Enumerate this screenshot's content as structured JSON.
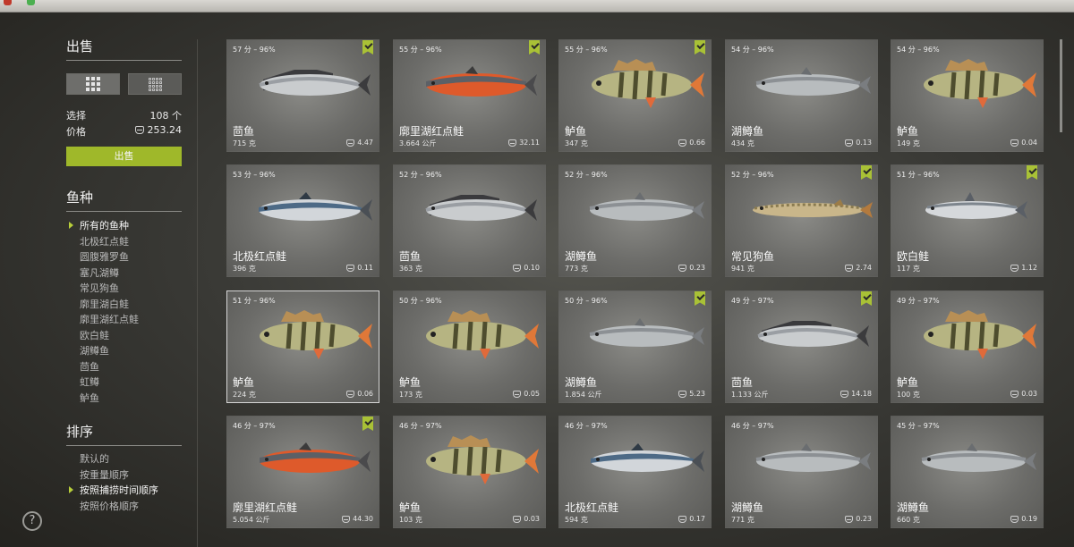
{
  "sidebar": {
    "sell_title": "出售",
    "select_label": "选择",
    "select_value": "108 个",
    "price_label": "价格",
    "price_value": "253.24",
    "sell_button": "出售",
    "species_title": "鱼种",
    "species": [
      {
        "label": "所有的鱼种",
        "selected": true
      },
      {
        "label": "北极红点鲑",
        "selected": false
      },
      {
        "label": "圆腹雅罗鱼",
        "selected": false
      },
      {
        "label": "塞凡湖鳟",
        "selected": false
      },
      {
        "label": "常见狗鱼",
        "selected": false
      },
      {
        "label": "廓里湖白鲑",
        "selected": false
      },
      {
        "label": "廓里湖红点鲑",
        "selected": false
      },
      {
        "label": "欧白鲑",
        "selected": false
      },
      {
        "label": "湖鳟鱼",
        "selected": false
      },
      {
        "label": "茴鱼",
        "selected": false
      },
      {
        "label": "虹鳟",
        "selected": false
      },
      {
        "label": "鲈鱼",
        "selected": false
      }
    ],
    "sort_title": "排序",
    "sort": [
      {
        "label": "默认的",
        "selected": false
      },
      {
        "label": "按重量顺序",
        "selected": false
      },
      {
        "label": "按照捕捞时间顺序",
        "selected": true
      },
      {
        "label": "按照价格顺序",
        "selected": false
      }
    ],
    "help_label": "?"
  },
  "fish": [
    {
      "score": "57 分 – 96%",
      "name": "茴鱼",
      "weight": "715 克",
      "price": "4.47",
      "checked": true,
      "kind": "grayling",
      "selected": false
    },
    {
      "score": "55 分 – 96%",
      "name": "廓里湖红点鲑",
      "weight": "3.664 公斤",
      "price": "32.11",
      "checked": true,
      "kind": "char_red",
      "selected": false
    },
    {
      "score": "55 分 – 96%",
      "name": "鲈鱼",
      "weight": "347 克",
      "price": "0.66",
      "checked": true,
      "kind": "perch",
      "selected": false
    },
    {
      "score": "54 分 – 96%",
      "name": "湖鳟鱼",
      "weight": "434 克",
      "price": "0.13",
      "checked": false,
      "kind": "trout",
      "selected": false
    },
    {
      "score": "54 分 – 96%",
      "name": "鲈鱼",
      "weight": "149 克",
      "price": "0.04",
      "checked": false,
      "kind": "perch",
      "selected": false
    },
    {
      "score": "53 分 – 96%",
      "name": "北极红点鲑",
      "weight": "396 克",
      "price": "0.11",
      "checked": false,
      "kind": "char_blue",
      "selected": false
    },
    {
      "score": "52 分 – 96%",
      "name": "茴鱼",
      "weight": "363 克",
      "price": "0.10",
      "checked": false,
      "kind": "grayling",
      "selected": false
    },
    {
      "score": "52 分 – 96%",
      "name": "湖鳟鱼",
      "weight": "773 克",
      "price": "0.23",
      "checked": false,
      "kind": "trout",
      "selected": false
    },
    {
      "score": "52 分 – 96%",
      "name": "常见狗鱼",
      "weight": "941 克",
      "price": "2.74",
      "checked": true,
      "kind": "pike",
      "selected": false
    },
    {
      "score": "51 分 – 96%",
      "name": "欧白鲑",
      "weight": "117 克",
      "price": "1.12",
      "checked": true,
      "kind": "whitefish",
      "selected": false
    },
    {
      "score": "51 分 – 96%",
      "name": "鲈鱼",
      "weight": "224 克",
      "price": "0.06",
      "checked": false,
      "kind": "perch",
      "selected": true
    },
    {
      "score": "50 分 – 96%",
      "name": "鲈鱼",
      "weight": "173 克",
      "price": "0.05",
      "checked": false,
      "kind": "perch",
      "selected": false
    },
    {
      "score": "50 分 – 96%",
      "name": "湖鳟鱼",
      "weight": "1.854 公斤",
      "price": "5.23",
      "checked": true,
      "kind": "trout",
      "selected": false
    },
    {
      "score": "49 分 – 97%",
      "name": "茴鱼",
      "weight": "1.133 公斤",
      "price": "14.18",
      "checked": true,
      "kind": "grayling",
      "selected": false
    },
    {
      "score": "49 分 – 97%",
      "name": "鲈鱼",
      "weight": "100 克",
      "price": "0.03",
      "checked": false,
      "kind": "perch",
      "selected": false
    },
    {
      "score": "46 分 – 97%",
      "name": "廓里湖红点鲑",
      "weight": "5.054 公斤",
      "price": "44.30",
      "checked": true,
      "kind": "char_red",
      "selected": false
    },
    {
      "score": "46 分 – 97%",
      "name": "鲈鱼",
      "weight": "103 克",
      "price": "0.03",
      "checked": false,
      "kind": "perch",
      "selected": false
    },
    {
      "score": "46 分 – 97%",
      "name": "北极红点鲑",
      "weight": "594 克",
      "price": "0.17",
      "checked": false,
      "kind": "char_blue",
      "selected": false
    },
    {
      "score": "46 分 – 97%",
      "name": "湖鳟鱼",
      "weight": "771 克",
      "price": "0.23",
      "checked": false,
      "kind": "trout",
      "selected": false
    },
    {
      "score": "45 分 – 97%",
      "name": "湖鳟鱼",
      "weight": "660 克",
      "price": "0.19",
      "checked": false,
      "kind": "trout",
      "selected": false
    }
  ],
  "colors": {
    "accent": "#9fb82a",
    "check": "#a9c136"
  }
}
